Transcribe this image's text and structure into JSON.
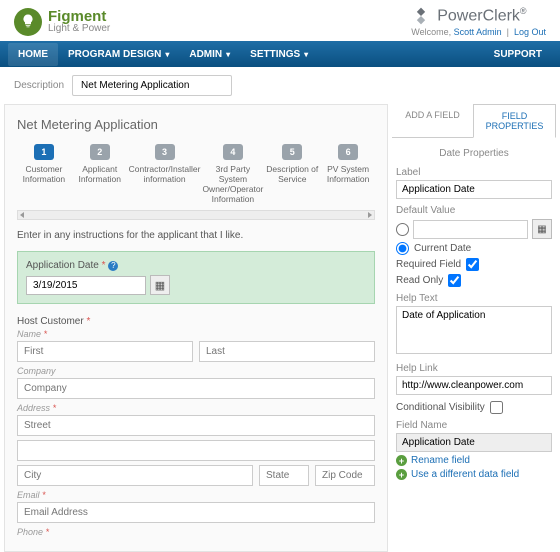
{
  "header": {
    "brand_left_title": "Figment",
    "brand_left_sub": "Light & Power",
    "brand_right": "PowerClerk",
    "welcome_prefix": "Welcome, ",
    "user": "Scott Admin",
    "logout": "Log Out"
  },
  "nav": {
    "home": "HOME",
    "program": "PROGRAM DESIGN",
    "admin": "ADMIN",
    "settings": "SETTINGS",
    "support": "SUPPORT"
  },
  "description": {
    "label": "Description",
    "value": "Net Metering Application"
  },
  "main": {
    "title": "Net Metering Application",
    "steps": [
      "Customer Information",
      "Applicant Information",
      "Contractor/Installer information",
      "3rd Party System Owner/Operator Information",
      "Description of Service",
      "PV System Information"
    ],
    "instructions": "Enter in any instructions for the applicant that I like.",
    "app_date_label": "Application Date ",
    "app_date_value": "3/19/2015",
    "host": {
      "title": "Host Customer ",
      "name_lbl": "Name ",
      "first_ph": "First",
      "last_ph": "Last",
      "company_lbl": "Company",
      "company_ph": "Company",
      "address_lbl": "Address ",
      "street_ph": "Street",
      "city_ph": "City",
      "state_ph": "State",
      "zip_ph": "Zip Code",
      "email_lbl": "Email ",
      "email_ph": "Email Address",
      "phone_lbl": "Phone "
    }
  },
  "side": {
    "tab_add": "ADD A FIELD",
    "tab_props": "FIELD PROPERTIES",
    "panel_title": "Date Properties",
    "label_lbl": "Label",
    "label_val": "Application Date",
    "default_lbl": "Default Value",
    "current_date": "Current Date",
    "required_lbl": "Required Field",
    "readonly_lbl": "Read Only",
    "help_text_lbl": "Help Text",
    "help_text_val": "Date of Application",
    "help_link_lbl": "Help Link",
    "help_link_val": "http://www.cleanpower.com",
    "cond_vis_lbl": "Conditional Visibility",
    "field_name_lbl": "Field Name",
    "field_name_val": "Application Date",
    "rename": "Rename field",
    "use_diff": "Use a different data field"
  }
}
